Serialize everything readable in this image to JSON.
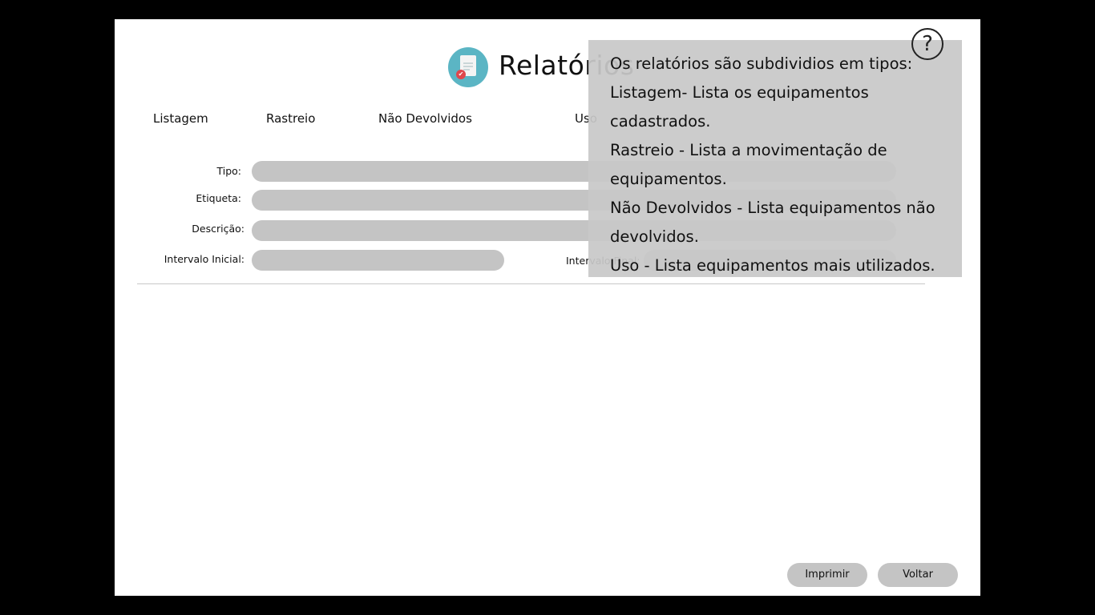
{
  "header": {
    "title": "Relatórios",
    "icon": "report-document-icon",
    "accent_color": "#5bb5c4"
  },
  "tabs": [
    {
      "label": "Listagem"
    },
    {
      "label": "Rastreio"
    },
    {
      "label": "Não Devolvidos"
    },
    {
      "label": "Uso"
    }
  ],
  "form": {
    "tipo_label": "Tipo:",
    "etiqueta_label": "Etiqueta:",
    "descricao_label": "Descrição:",
    "intervalo_inicial_label": "Intervalo Inicial:",
    "intervalo_final_label": "Intervalo Final:"
  },
  "tooltip": {
    "lines": [
      "Os relatórios são subdividios em tipos:",
      "Listagem- Lista os equipamentos",
      "cadastrados.",
      "Rastreio - Lista a movimentação de",
      "equipamentos.",
      "Não Devolvidos - Lista equipamentos não",
      "devolvidos.",
      "Uso - Lista equipamentos mais utilizados."
    ]
  },
  "help": {
    "icon": "help-question-icon",
    "symbol": "?"
  },
  "buttons": {
    "print_label": "Imprimir",
    "back_label": "Voltar"
  }
}
